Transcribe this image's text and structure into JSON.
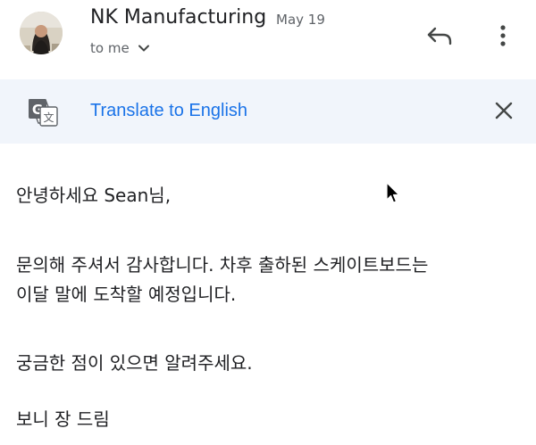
{
  "header": {
    "sender": "NK Manufacturing",
    "date": "May 19",
    "recipient": "to me",
    "avatar": "avatar-photo",
    "reply_icon": "reply-icon",
    "more_icon": "more-vert-icon"
  },
  "translate_bar": {
    "icon": "google-translate-icon",
    "link_label": "Translate to English",
    "close_icon": "close-icon"
  },
  "message": {
    "greeting": "안녕하세요 Sean님,",
    "paragraph_line1": "문의해 주셔서 감사합니다. 차후 출하된 스케이트보드는",
    "paragraph_line2": "이달 말에 도착할 예정입니다.",
    "closing": "궁금한 점이 있으면 알려주세요.",
    "signature": "보니 장 드림"
  },
  "colors": {
    "link": "#1a73e8",
    "secondary_text": "#5f6368",
    "translate_bar_bg": "#f1f5fb"
  }
}
